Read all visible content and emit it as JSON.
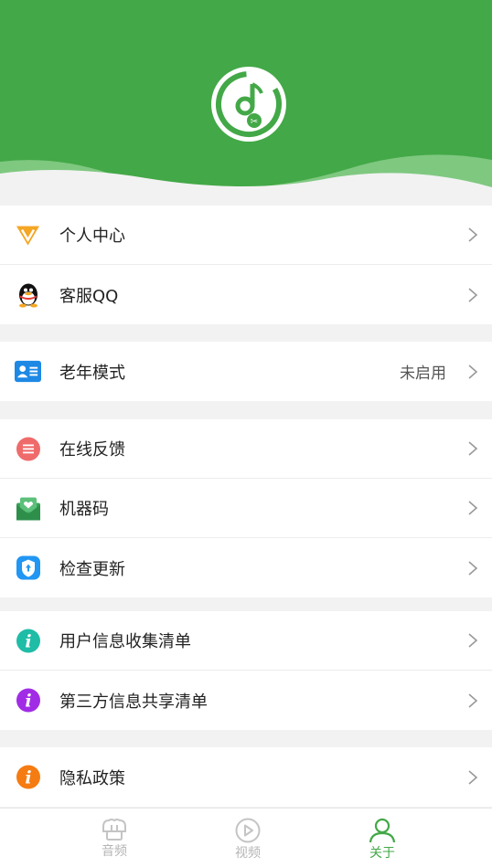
{
  "menu": {
    "group1": [
      {
        "label": "个人中心",
        "icon": "vip-diamond-icon"
      },
      {
        "label": "客服QQ",
        "icon": "qq-penguin-icon"
      }
    ],
    "group2": [
      {
        "label": "老年模式",
        "value": "未启用",
        "icon": "id-card-icon"
      }
    ],
    "group3": [
      {
        "label": "在线反馈",
        "icon": "feedback-icon"
      },
      {
        "label": "机器码",
        "icon": "envelope-heart-icon"
      },
      {
        "label": "检查更新",
        "icon": "update-shield-icon"
      }
    ],
    "group4": [
      {
        "label": "用户信息收集清单",
        "icon": "info-icon"
      },
      {
        "label": "第三方信息共享清单",
        "icon": "info-icon"
      }
    ],
    "group5": [
      {
        "label": "隐私政策",
        "icon": "info-icon"
      }
    ]
  },
  "tabs": [
    {
      "label": "音频",
      "icon": "audio-tab-icon",
      "active": false
    },
    {
      "label": "视频",
      "icon": "video-play-icon",
      "active": false
    },
    {
      "label": "关于",
      "icon": "person-icon",
      "active": true
    }
  ],
  "colors": {
    "brand": "#43a847",
    "info_teal": "#1fbca6",
    "info_purple": "#a12ce6",
    "info_orange": "#f57c12"
  }
}
